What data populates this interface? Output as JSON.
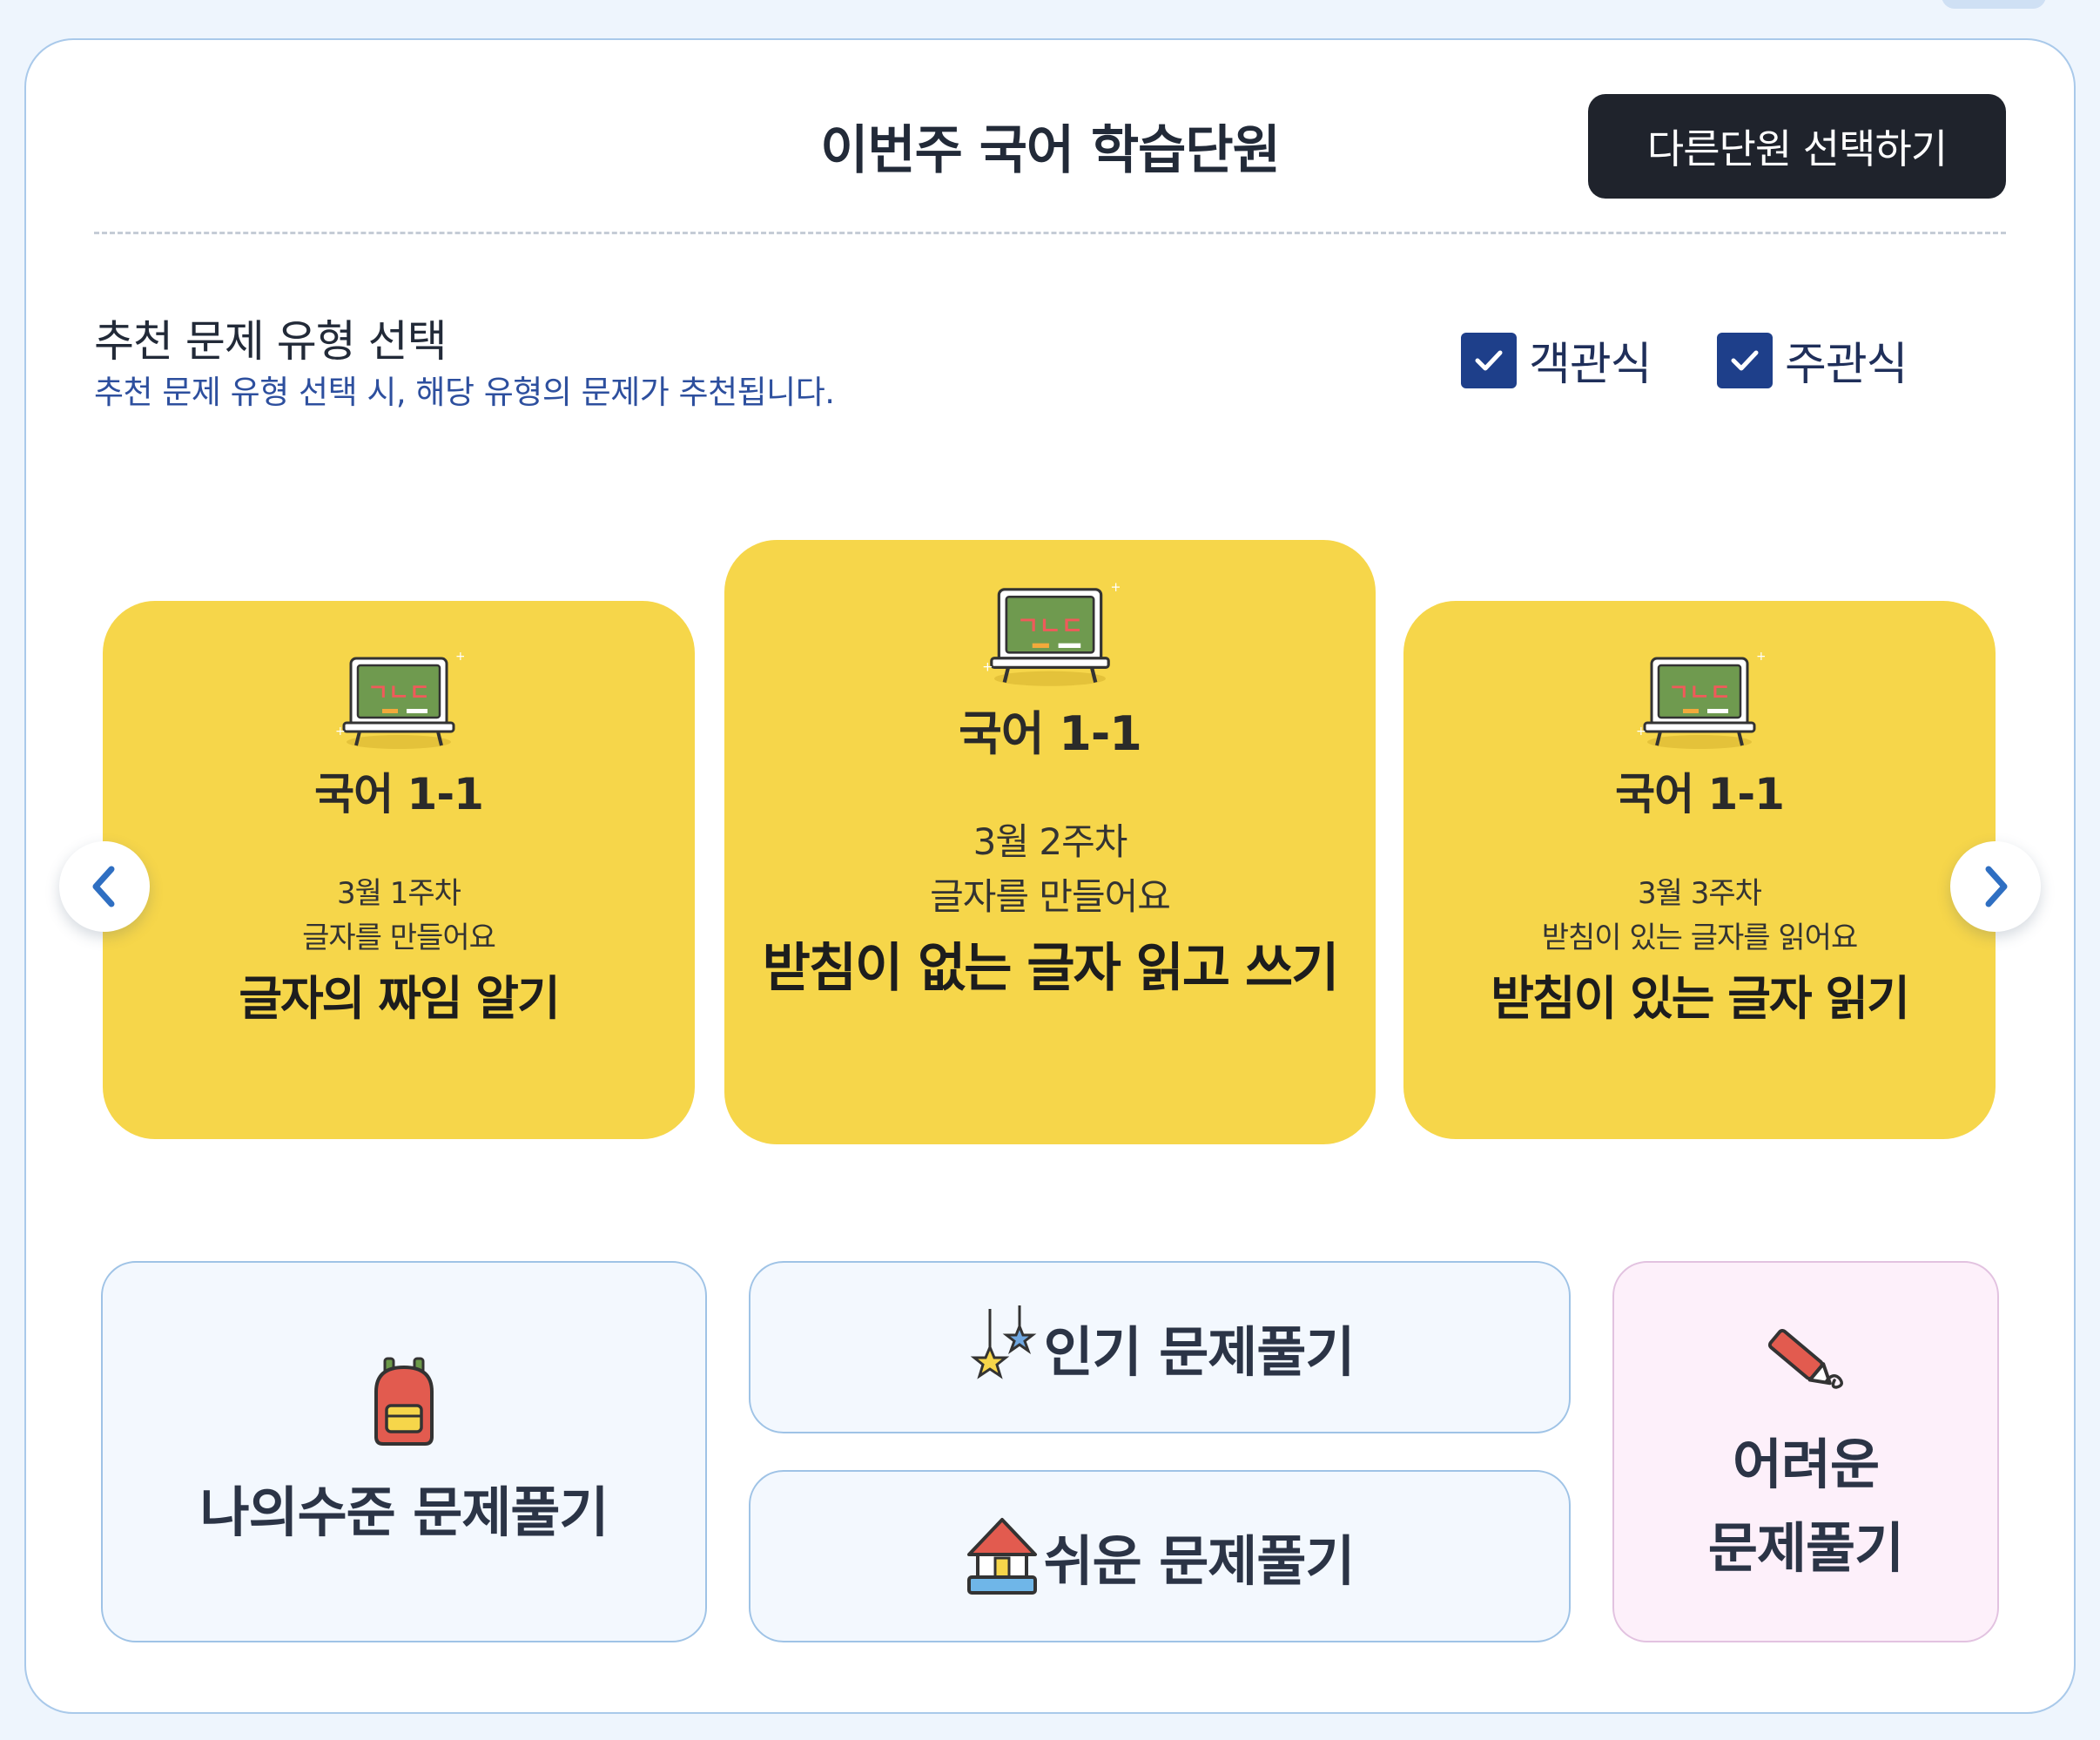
{
  "header": {
    "title": "이번주 국어 학습단원",
    "other_unit_button": "다른단원 선택하기"
  },
  "recommend": {
    "title": "추천 문제 유형 선택",
    "subtitle": "추천 문제 유형 선택 시, 해당 유형의 문제가 추천됩니다.",
    "options": [
      {
        "label": "객관식",
        "checked": true
      },
      {
        "label": "주관식",
        "checked": true
      }
    ]
  },
  "cards": [
    {
      "course": "국어 1-1",
      "week": "3월 1주차",
      "sub": "글자를 만들어요",
      "unit": "글자의 짜임 알기"
    },
    {
      "course": "국어 1-1",
      "week": "3월 2주차",
      "sub": "글자를 만들어요",
      "unit": "받침이 없는 글자 읽고 쓰기"
    },
    {
      "course": "국어 1-1",
      "week": "3월 3주차",
      "sub": "받침이 있는 글자를 읽어요",
      "unit": "받침이 있는 글자 읽기"
    }
  ],
  "board_letters": "ㄱㄴㄷ",
  "actions": {
    "my_level": "나의수준 문제풀기",
    "popular": "인기 문제풀기",
    "easy": "쉬운 문제풀기",
    "hard_line1": "어려운",
    "hard_line2": "문제풀기"
  },
  "colors": {
    "card_yellow": "#f6d64a",
    "dark_button": "#1f232c",
    "checkbox": "#1e3f8a",
    "subtitle_blue": "#2d4f9e"
  },
  "icons": {
    "prev": "chevron-left-icon",
    "next": "chevron-right-icon",
    "check": "checkmark-icon",
    "board": "chalkboard-icon",
    "backpack": "backpack-icon",
    "stars": "stars-icon",
    "house": "house-icon",
    "pencil": "pencil-icon"
  }
}
